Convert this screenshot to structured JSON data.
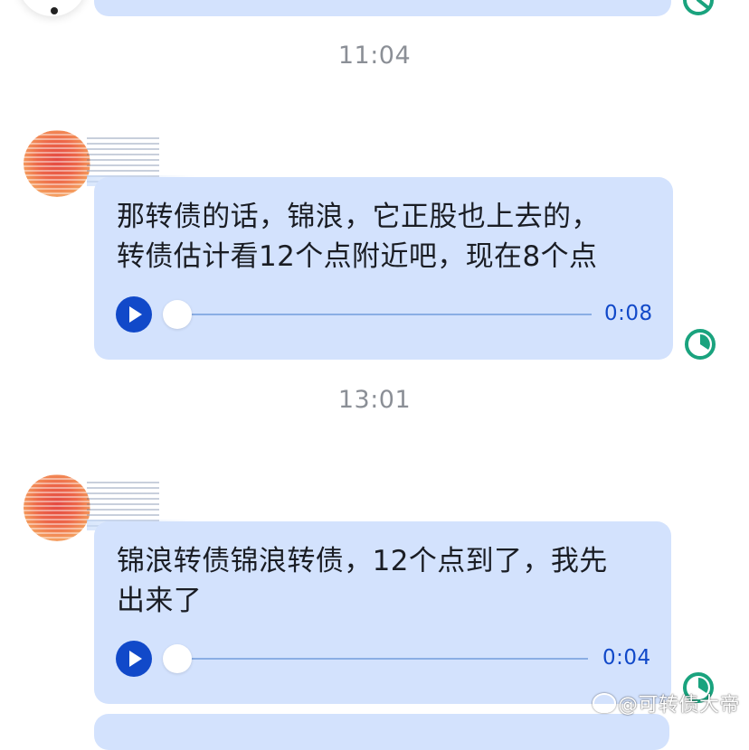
{
  "messages": [
    {
      "timestamp": "11:04",
      "text_line1": "那转债的话，锦浪，它正股也上去的，",
      "text_line2": "转债估计看12个点附近吧，现在8个点",
      "duration": "0:08"
    },
    {
      "timestamp": "13:01",
      "text_line1": "锦浪转债锦浪转债，12个点到了，我先",
      "text_line2": "出来了",
      "duration": "0:04"
    }
  ],
  "watermark": {
    "text": "@可转债大帝"
  },
  "colors": {
    "bubble": "#d3e2fd",
    "accent": "#1149c9",
    "status_green": "#1aa37e",
    "timestamp": "#8b8f96"
  },
  "icons": {
    "play": "play-icon",
    "status": "clock-status-icon",
    "weibo": "weibo-icon"
  }
}
